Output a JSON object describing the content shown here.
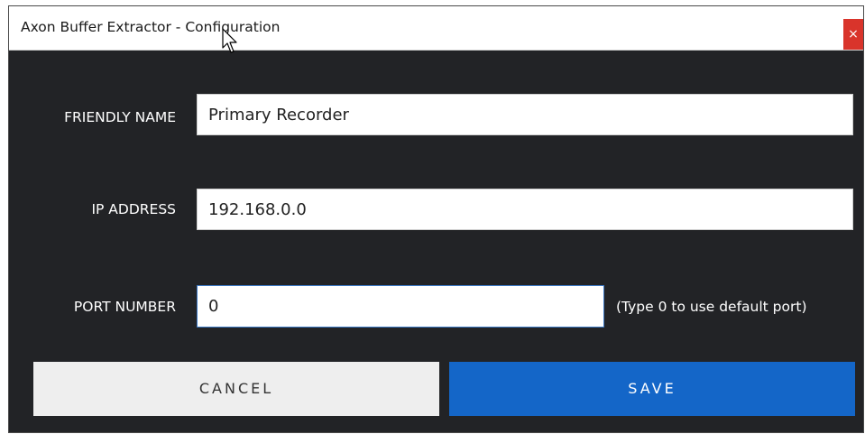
{
  "window": {
    "title": "Axon Buffer Extractor - Configuration",
    "close_glyph": "×"
  },
  "form": {
    "friendly_name": {
      "label": "FRIENDLY NAME",
      "value": "Primary Recorder"
    },
    "ip_address": {
      "label": "IP ADDRESS",
      "value": "192.168.0.0"
    },
    "port_number": {
      "label": "PORT NUMBER",
      "value": "0",
      "hint": "(Type 0 to use default port)"
    }
  },
  "buttons": {
    "cancel_label": "CANCEL",
    "save_label": "SAVE"
  },
  "colors": {
    "background": "#222326",
    "save_button": "#1466c8",
    "cancel_button": "#eeeeee",
    "close_button": "#d9342b"
  },
  "icons": {
    "close": "close-icon",
    "cursor": "mouse-pointer-icon"
  }
}
